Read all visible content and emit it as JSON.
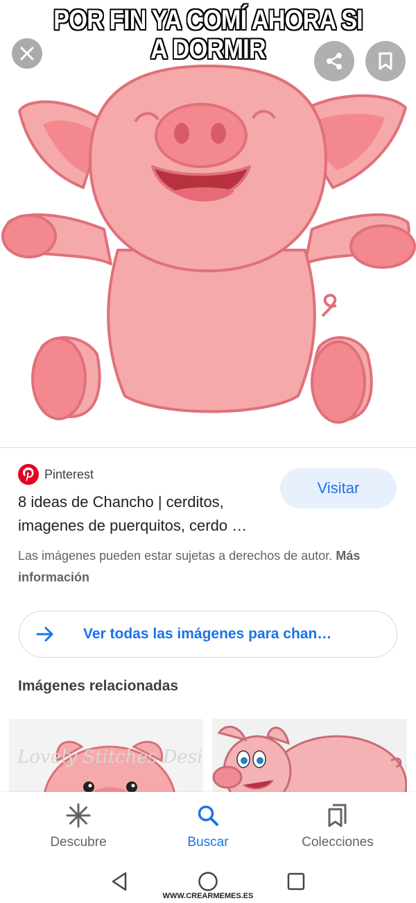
{
  "meme": {
    "caption_line1": "POR FIN YA COMÍ AHORA SI",
    "caption_line2": "A DORMIR",
    "site_credit": "WWW.CREARMEMES.ES"
  },
  "hero": {
    "close_icon": "close-icon",
    "share_icon": "share-icon",
    "save_icon": "bookmark-icon"
  },
  "result": {
    "source": "Pinterest",
    "title": "8 ideas de Chancho | cerditos, imagenes de puerquitos, cerdo …",
    "visit_label": "Visitar",
    "copyright_text": "Las imágenes pueden estar sujetas a derechos de autor.",
    "more_info": "Más información"
  },
  "see_all": {
    "label": "Ver todas las imágenes para chan…"
  },
  "related": {
    "title": "Imágenes relacionadas",
    "watermark": "Lovely Stitches Design"
  },
  "bottom_nav": {
    "items": [
      {
        "label": "Descubre",
        "icon": "asterisk-icon",
        "active": false
      },
      {
        "label": "Buscar",
        "icon": "search-icon",
        "active": true
      },
      {
        "label": "Colecciones",
        "icon": "collections-icon",
        "active": false
      }
    ]
  },
  "colors": {
    "accent": "#1a73e8",
    "pinterest": "#e60023",
    "pig_pink": "#f6a9aa",
    "pig_outline": "#e0707a"
  }
}
